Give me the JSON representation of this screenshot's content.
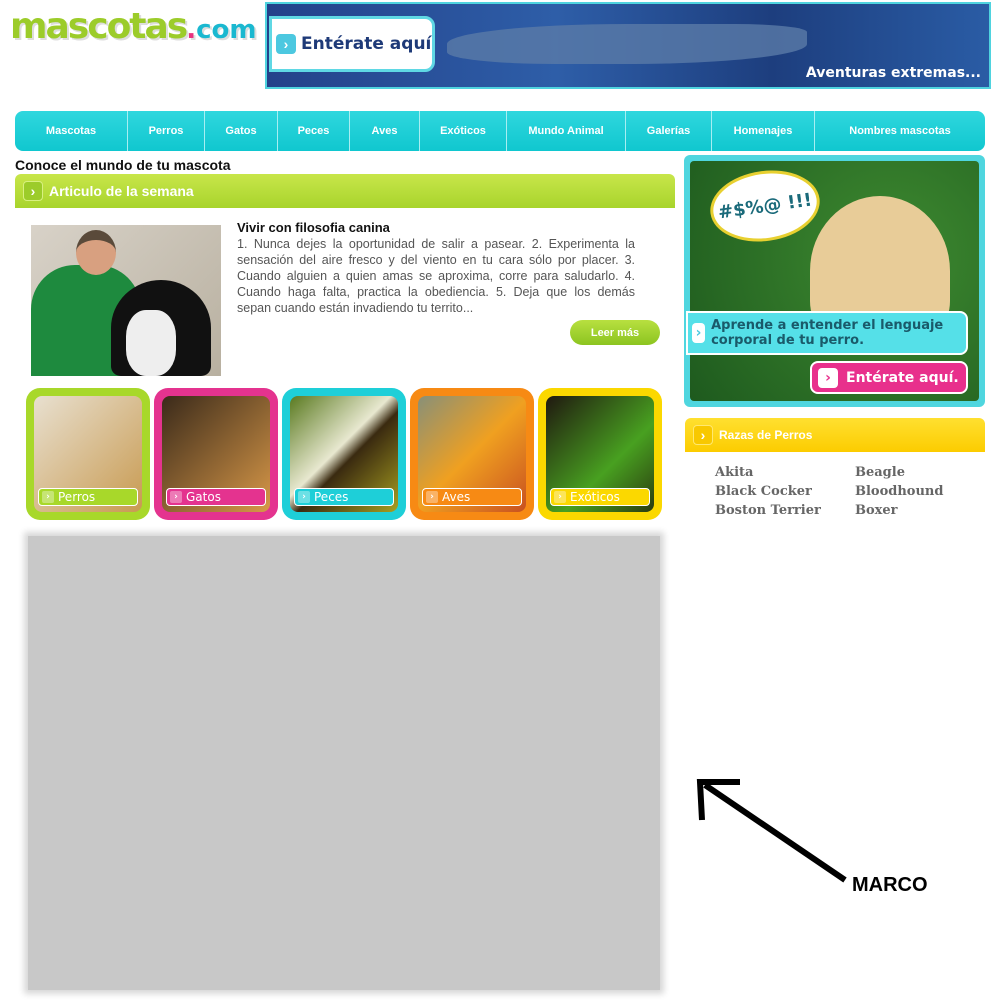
{
  "logo": {
    "main": "mascotas",
    "dot": ".",
    "com": "com"
  },
  "banner": {
    "cta": "Entérate aquí",
    "tagline": "Aventuras extremas..."
  },
  "nav": [
    {
      "label": "Mascotas"
    },
    {
      "label": "Perros"
    },
    {
      "label": "Gatos"
    },
    {
      "label": "Peces"
    },
    {
      "label": "Aves"
    },
    {
      "label": "Exóticos"
    },
    {
      "label": "Mundo Animal"
    },
    {
      "label": "Galerías"
    },
    {
      "label": "Homenajes"
    },
    {
      "label": "Nombres mascotas"
    }
  ],
  "main": {
    "subtitle": "Conoce el mundo de tu mascota",
    "section_title": "Articulo de la semana",
    "article": {
      "title": "Vivir con filosofia canina",
      "body": "1. Nunca dejes la oportunidad de salir a pasear. 2. Experimenta la sensación del aire fresco y del viento en tu cara sólo por placer. 3. Cuando alguien a quien amas se aproxima, corre para saludarlo. 4. Cuando haga falta, practica la obediencia. 5. Deja que los demás sepan cuando están invadiendo tu territo...",
      "read_more": "Leer más"
    },
    "categories": [
      {
        "label": "Perros",
        "color": "#a8d82a"
      },
      {
        "label": "Gatos",
        "color": "#e4338f"
      },
      {
        "label": "Peces",
        "color": "#1ecfd8"
      },
      {
        "label": "Aves",
        "color": "#f78a14"
      },
      {
        "label": "Exóticos",
        "color": "#fbd800"
      }
    ]
  },
  "sidebar": {
    "ad": {
      "bubble": "#$%@ !!!",
      "message": "Aprende a entender el lenguaje corporal de tu perro.",
      "cta": "Entérate aquí."
    },
    "breeds_title": "Razas de Perros",
    "breeds": [
      "Akita",
      "Beagle",
      "Black Cocker",
      "Bloodhound",
      "Boston Terrier",
      "Boxer"
    ]
  },
  "annotation": {
    "label": "MARCO"
  }
}
